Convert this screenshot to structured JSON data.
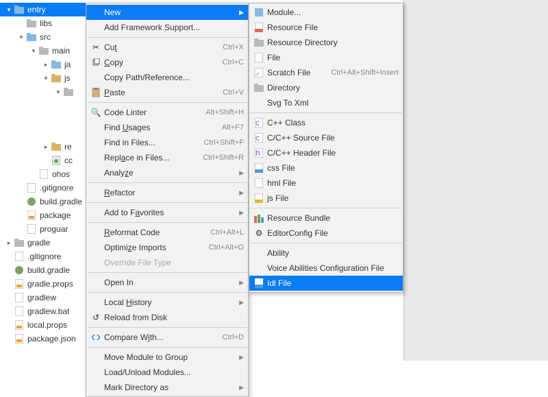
{
  "tree": {
    "entry": "entry",
    "libs": "libs",
    "src": "src",
    "main": "main",
    "ja": "ja",
    "js": "js",
    "re": "re",
    "cc": "cc",
    "ohos": "ohos",
    "gitignore": ".gitignore",
    "buildgradle": "build.gradle",
    "package": "package",
    "proguar": "proguar",
    "gradle": "gradle",
    "gitignore2": ".gitignore",
    "buildgradle2": "build.gradle",
    "gradleprops": "gradle.props",
    "gradlew": "gradlew",
    "gradlewbat": "gradlew.bat",
    "localprops": "local.props",
    "packagejson": "package.json"
  },
  "menu1": {
    "new": "New",
    "addfw": "Add Framework Support...",
    "cut": "Cut",
    "cut_sc": "Ctrl+X",
    "copy": "Copy",
    "copy_sc": "Ctrl+C",
    "copypath": "Copy Path/Reference...",
    "paste": "Paste",
    "paste_sc": "Ctrl+V",
    "codelinter": "Code Linter",
    "codelinter_sc": "Alt+Shift+H",
    "findusages": "Find Usages",
    "findusages_sc": "Alt+F7",
    "findinfiles": "Find in Files...",
    "findinfiles_sc": "Ctrl+Shift+F",
    "replaceinfiles": "Replace in Files...",
    "replaceinfiles_sc": "Ctrl+Shift+R",
    "analyze": "Analyze",
    "refactor": "Refactor",
    "addfav": "Add to Favorites",
    "reformat": "Reformat Code",
    "reformat_sc": "Ctrl+Alt+L",
    "optimports": "Optimize Imports",
    "optimports_sc": "Ctrl+Alt+O",
    "overrideft": "Override File Type",
    "openin": "Open In",
    "localhist": "Local History",
    "reload": "Reload from Disk",
    "compare": "Compare With...",
    "compare_sc": "Ctrl+D",
    "movemod": "Move Module to Group",
    "loadunload": "Load/Unload Modules...",
    "markdir": "Mark Directory as"
  },
  "menu2": {
    "module": "Module...",
    "resfile": "Resource File",
    "resdir": "Resource Directory",
    "file": "File",
    "scratch": "Scratch File",
    "scratch_sc": "Ctrl+Alt+Shift+Insert",
    "directory": "Directory",
    "svgxml": "Svg To Xml",
    "cppclass": "C++ Class",
    "cppsrc": "C/C++ Source File",
    "cpphdr": "C/C++ Header File",
    "cssfile": "css File",
    "hmlfile": "hml File",
    "jsfile": "js File",
    "resbundle": "Resource Bundle",
    "editorconfig": "EditorConfig File",
    "ability": "Ability",
    "voiceab": "Voice Abilities Configuration File",
    "idlfile": "Idl File"
  }
}
